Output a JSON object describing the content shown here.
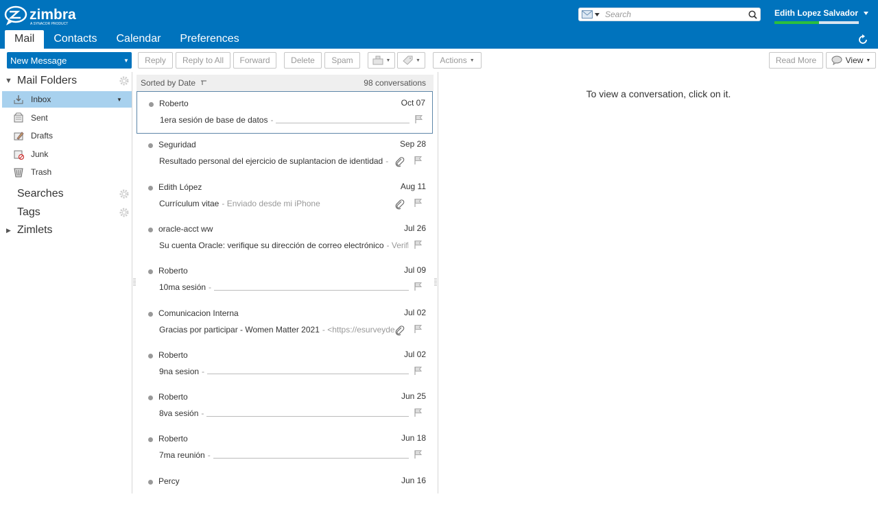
{
  "header": {
    "brand": "zimbra",
    "brand_sub": "A SYNACOR PRODUCT",
    "search_placeholder": "Search",
    "user_name": "Edith Lopez Salvador",
    "quota_used_fraction": 0.53,
    "colors": {
      "brand_blue": "#0073bd",
      "quota_green": "#2bbf3c"
    }
  },
  "app_tabs": [
    {
      "label": "Mail",
      "active": true
    },
    {
      "label": "Contacts",
      "active": false
    },
    {
      "label": "Calendar",
      "active": false
    },
    {
      "label": "Preferences",
      "active": false
    }
  ],
  "toolbar": {
    "new_message": "New Message",
    "reply": "Reply",
    "reply_all": "Reply to All",
    "forward": "Forward",
    "delete": "Delete",
    "spam": "Spam",
    "actions": "Actions",
    "read_more": "Read More",
    "view": "View"
  },
  "sidebar": {
    "mail_folders": "Mail Folders",
    "folders": [
      {
        "label": "Inbox",
        "icon": "inbox-icon",
        "selected": true
      },
      {
        "label": "Sent",
        "icon": "sent-icon",
        "selected": false
      },
      {
        "label": "Drafts",
        "icon": "drafts-icon",
        "selected": false
      },
      {
        "label": "Junk",
        "icon": "junk-icon",
        "selected": false
      },
      {
        "label": "Trash",
        "icon": "trash-icon",
        "selected": false
      }
    ],
    "searches": "Searches",
    "tags": "Tags",
    "zimlets": "Zimlets"
  },
  "list": {
    "sorted_by": "Sorted by Date",
    "count": "98 conversations",
    "conversations": [
      {
        "from": "Roberto",
        "date": "Oct 07",
        "subject": "1era sesión de base de datos",
        "fragment": "-",
        "underline": true,
        "attachment": false,
        "selected": true
      },
      {
        "from": "Seguridad",
        "date": "Sep 28",
        "subject": "Resultado personal del ejercicio de suplantacion de identidad",
        "fragment": "-",
        "underline": false,
        "attachment": true,
        "selected": false
      },
      {
        "from": "Edith López",
        "date": "Aug 11",
        "subject": "Currículum vitae",
        "fragment": "- Enviado desde mi iPhone",
        "underline": false,
        "attachment": true,
        "selected": false
      },
      {
        "from": "oracle-acct ww",
        "date": "Jul 26",
        "subject": "Su cuenta Oracle: verifique su dirección de correo electrónico",
        "fragment": "- Verifi",
        "underline": false,
        "attachment": false,
        "selected": false
      },
      {
        "from": "Roberto",
        "date": "Jul 09",
        "subject": "10ma sesión",
        "fragment": "-",
        "underline": true,
        "attachment": false,
        "selected": false
      },
      {
        "from": "Comunicacion Interna",
        "date": "Jul 02",
        "subject": "Gracias por participar - Women Matter 2021",
        "fragment": "- <https://esurveyde",
        "underline": false,
        "attachment": true,
        "selected": false
      },
      {
        "from": "Roberto",
        "date": "Jul 02",
        "subject": "9na sesion",
        "fragment": "-",
        "underline": true,
        "attachment": false,
        "selected": false
      },
      {
        "from": "Roberto",
        "date": "Jun 25",
        "subject": "8va sesión",
        "fragment": "-",
        "underline": true,
        "attachment": false,
        "selected": false
      },
      {
        "from": "Roberto",
        "date": "Jun 18",
        "subject": "7ma reunión",
        "fragment": "-",
        "underline": true,
        "attachment": false,
        "selected": false
      },
      {
        "from": "Percy",
        "date": "Jun 16",
        "subject": "",
        "fragment": "",
        "underline": false,
        "attachment": false,
        "selected": false
      }
    ]
  },
  "reading_pane": {
    "message": "To view a conversation, click on it."
  }
}
